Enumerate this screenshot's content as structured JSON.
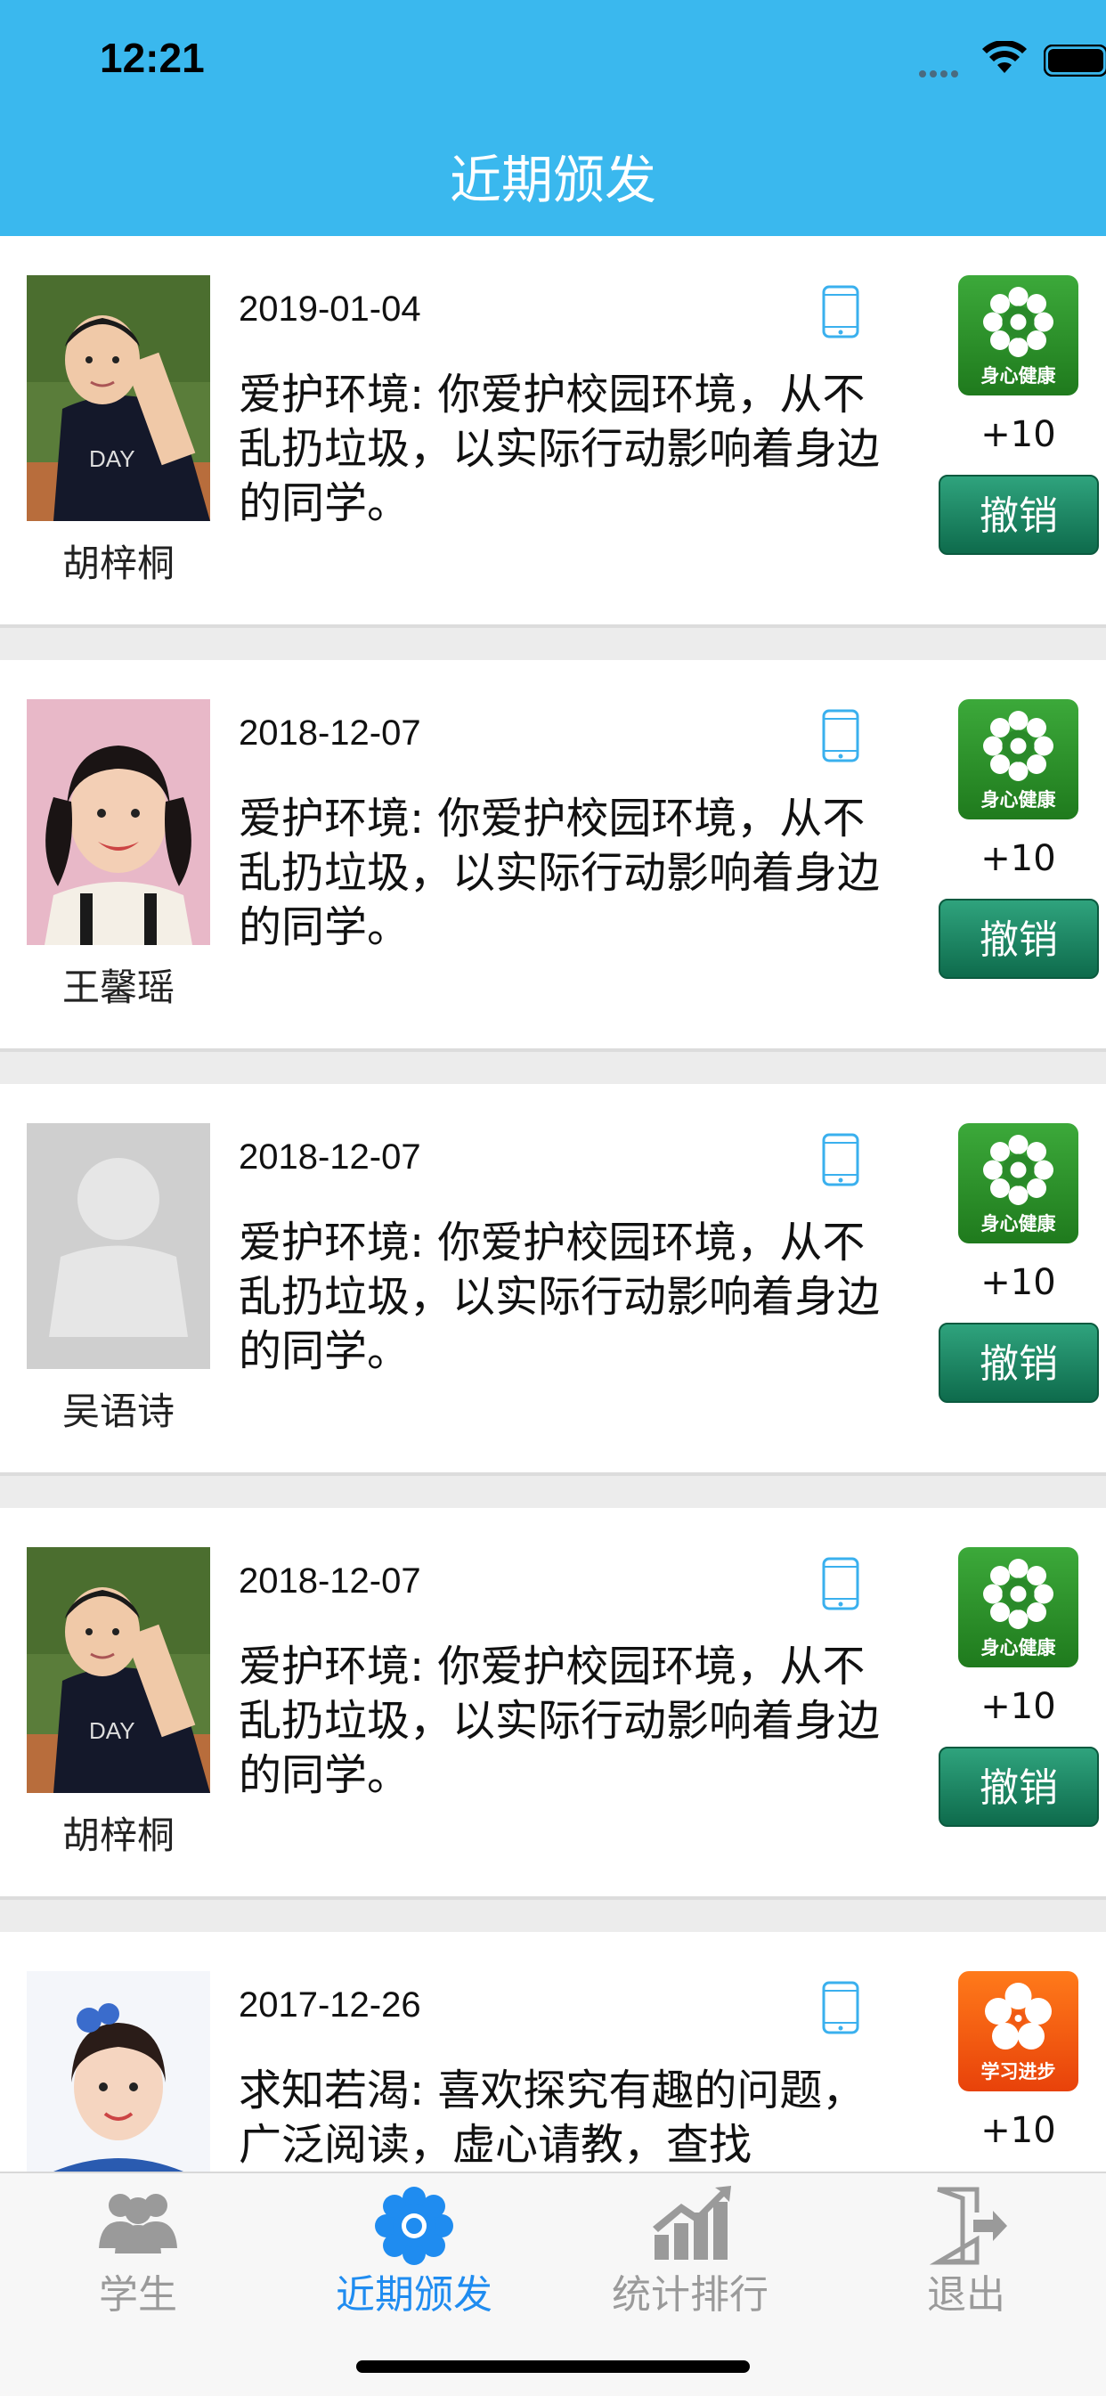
{
  "status_bar": {
    "time": "12:21"
  },
  "nav": {
    "title": "近期颁发"
  },
  "records": [
    {
      "name": "胡梓桐",
      "date": "2019-01-04",
      "description": "爱护环境: 你爱护校园环境，从不乱扔垃圾，以实际行动影响着身边的同学。",
      "badge": "身心健康",
      "badge_color": "#2e9630",
      "points": "+10",
      "action": "撤销",
      "avatar": "boy"
    },
    {
      "name": "王馨瑶",
      "date": "2018-12-07",
      "description": "爱护环境: 你爱护校园环境，从不乱扔垃圾，以实际行动影响着身边的同学。",
      "badge": "身心健康",
      "badge_color": "#2e9630",
      "points": "+10",
      "action": "撤销",
      "avatar": "girl"
    },
    {
      "name": "吴语诗",
      "date": "2018-12-07",
      "description": "爱护环境: 你爱护校园环境，从不乱扔垃圾，以实际行动影响着身边的同学。",
      "badge": "身心健康",
      "badge_color": "#2e9630",
      "points": "+10",
      "action": "撤销",
      "avatar": "placeholder"
    },
    {
      "name": "胡梓桐",
      "date": "2018-12-07",
      "description": "爱护环境: 你爱护校园环境，从不乱扔垃圾，以实际行动影响着身边的同学。",
      "badge": "身心健康",
      "badge_color": "#2e9630",
      "points": "+10",
      "action": "撤销",
      "avatar": "boy"
    },
    {
      "name": "",
      "date": "2017-12-26",
      "description": "求知若渴: 喜欢探究有趣的问题，广泛阅读，虚心请教，查找",
      "badge": "学习进步",
      "badge_color": "#f05a14",
      "points": "+10",
      "action": "",
      "avatar": "girl2"
    }
  ],
  "tabs": [
    {
      "label": "学生",
      "icon": "students-icon",
      "active": false
    },
    {
      "label": "近期颁发",
      "icon": "flower-icon",
      "active": true
    },
    {
      "label": "统计排行",
      "icon": "chart-icon",
      "active": false
    },
    {
      "label": "退出",
      "icon": "exit-icon",
      "active": false
    }
  ],
  "colors": {
    "header": "#3ab8ee",
    "active_tab": "#1f8cf0",
    "revoke_button": "#1a8a62"
  }
}
